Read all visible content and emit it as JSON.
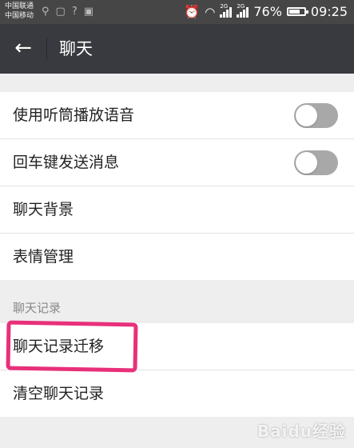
{
  "status_bar": {
    "carrier_1": "中国联通",
    "carrier_2": "中国移动",
    "battery_percent": "76%",
    "battery_level": 0.76,
    "time": "09:25",
    "net_1": "2G",
    "net_2": "2G",
    "icons": [
      "location-icon",
      "notification-icon",
      "wifi-small-icon",
      "image-icon",
      "alarm-icon",
      "wifi-icon",
      "signal-icon",
      "signal-icon",
      "battery-icon"
    ]
  },
  "app_bar": {
    "back_icon": "←",
    "title": "聊天"
  },
  "settings": {
    "group1": [
      {
        "label": "使用听筒播放语音",
        "toggle": false
      },
      {
        "label": "回车键发送消息",
        "toggle": false
      },
      {
        "label": "聊天背景"
      },
      {
        "label": "表情管理"
      }
    ],
    "section_title": "聊天记录",
    "group2": [
      {
        "label": "聊天记录迁移"
      },
      {
        "label": "清空聊天记录"
      }
    ]
  },
  "annotation_color": "#e8307a",
  "watermark": "Baidu经验"
}
